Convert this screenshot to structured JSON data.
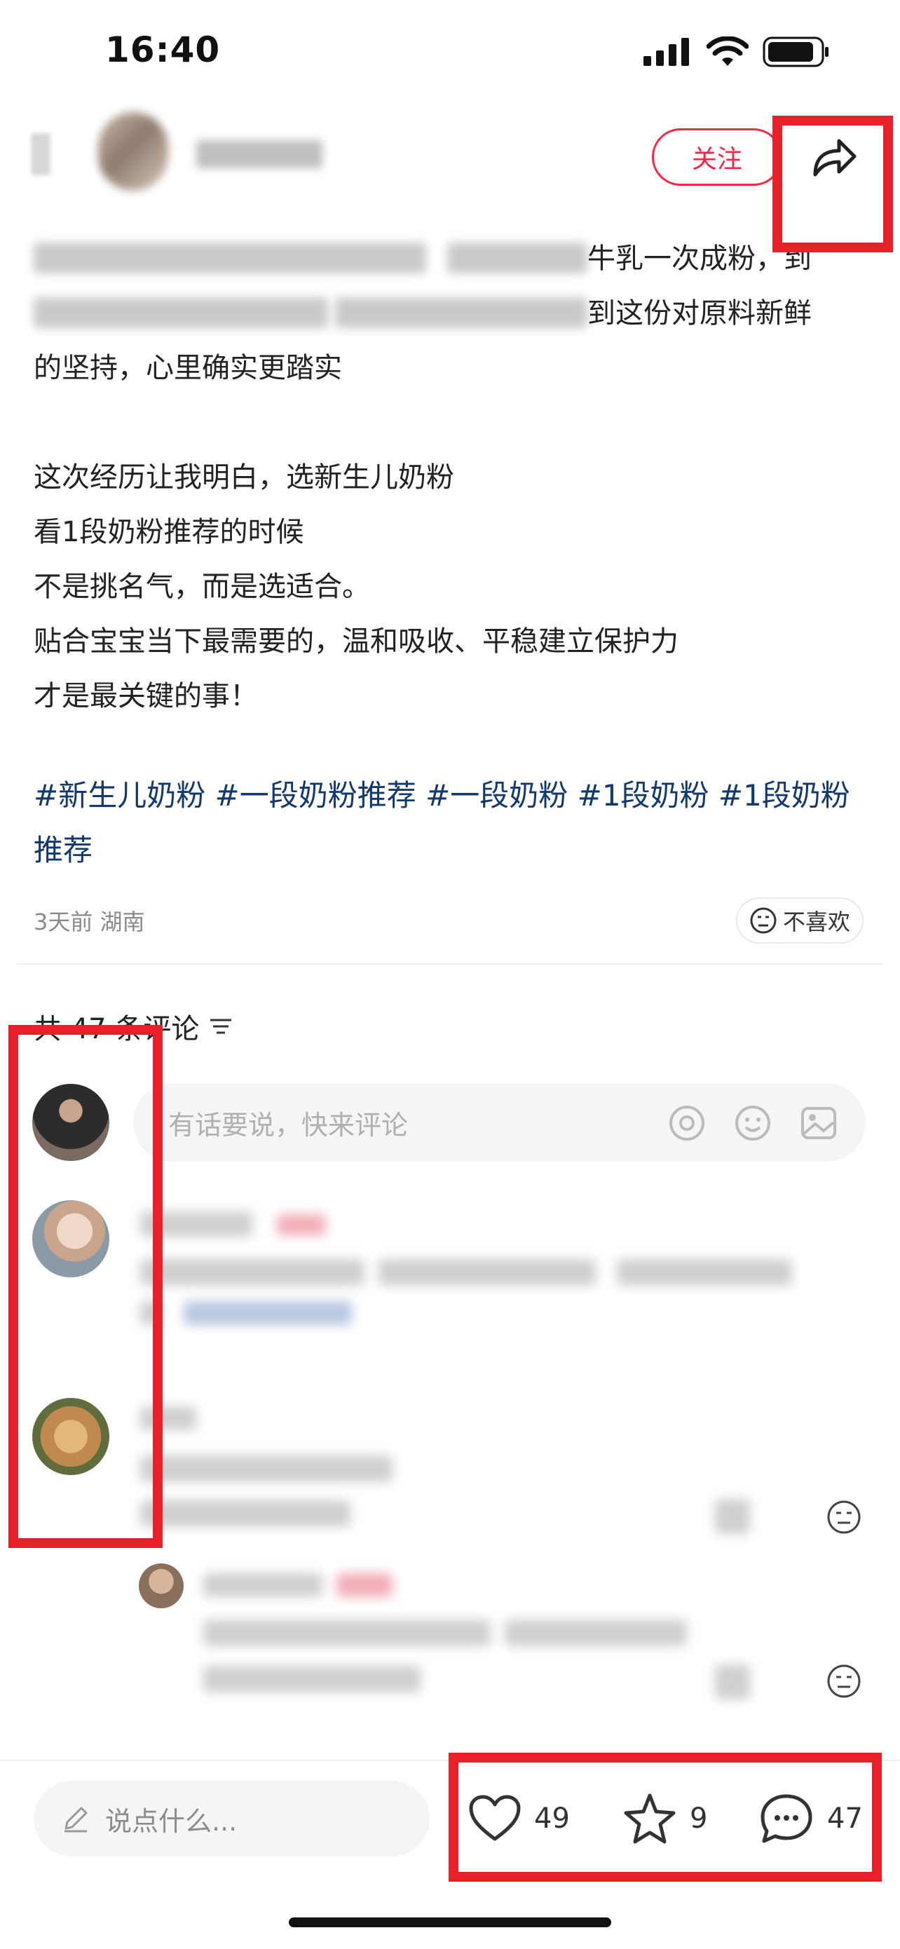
{
  "status_bar": {
    "time": "16:40"
  },
  "header": {
    "follow_label": "关注"
  },
  "post": {
    "line1_visible": "牛乳一次成粉，到",
    "line2_visible": "到这份对原料新鲜",
    "line3": "的坚持，心里确实更踏实",
    "paragraph2": [
      "这次经历让我明白，选新生儿奶粉",
      "看1段奶粉推荐的时候",
      "不是挑名气，而是选适合。",
      "贴合宝宝当下最需要的，温和吸收、平稳建立保护力",
      "才是最关键的事！"
    ],
    "hashtags": "#新生儿奶粉 #一段奶粉推荐 #一段奶粉 #1段奶粉 #1段奶粉推荐",
    "meta": "3天前 湖南",
    "dislike_label": "不喜欢"
  },
  "comments": {
    "title": "共 47 条评论",
    "input_placeholder": "有话要说，快来评论"
  },
  "bottom_bar": {
    "input_placeholder": "说点什么...",
    "likes": "49",
    "collects": "9",
    "comments": "47"
  },
  "colors": {
    "accent": "#ff2442",
    "hashtag": "#13386c",
    "annotation": "#e8202a"
  },
  "icons": [
    "signal-icon",
    "wifi-icon",
    "battery-icon",
    "share-icon",
    "filter-icon",
    "at-icon",
    "emoji-icon",
    "image-icon",
    "pencil-icon",
    "heart-icon",
    "star-icon",
    "comment-icon",
    "dislike-face-icon"
  ]
}
